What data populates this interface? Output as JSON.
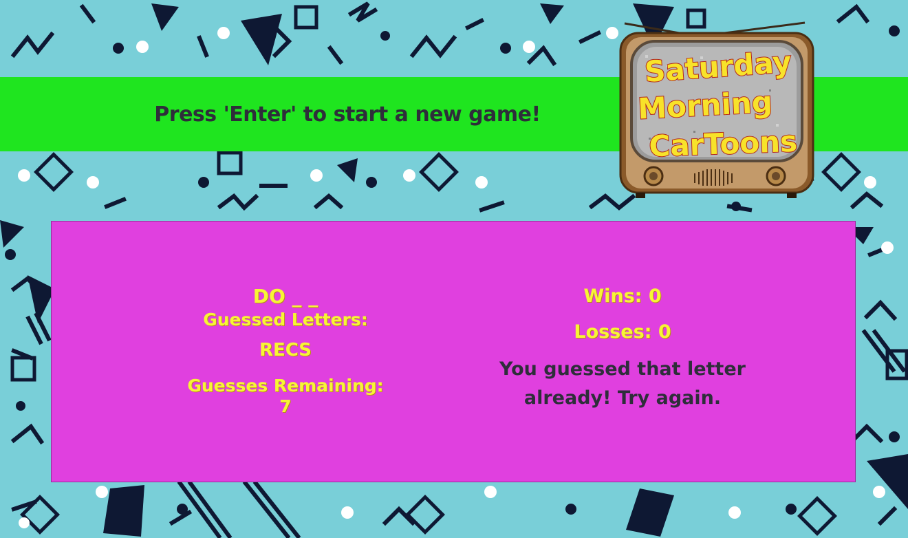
{
  "banner": {
    "instruction": "Press 'Enter' to start a new game!"
  },
  "logo": {
    "line1": "Saturday",
    "line2": "Morning",
    "line3": "CarToons"
  },
  "game": {
    "current_word": "DO _ _",
    "guessed_label": "Guessed Letters:",
    "guessed_letters": "RECS",
    "guesses_remaining": "Guesses Remaining: 7",
    "wins": "Wins: 0",
    "losses": "Losses: 0",
    "message": "You guessed that letter already! Try again."
  },
  "colors": {
    "background": "#79cfd8",
    "banner": "#1fe51f",
    "panel": "#e040df",
    "accent_text": "#f7f535",
    "dark_text": "#2e2e3a"
  }
}
